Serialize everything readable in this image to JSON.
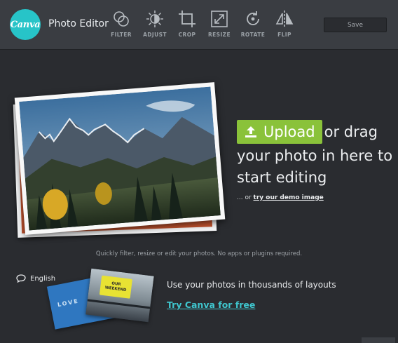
{
  "header": {
    "logo_text": "Canva",
    "app_title": "Photo Editor",
    "tools": [
      {
        "label": "FILTER",
        "icon": "filter-icon"
      },
      {
        "label": "ADJUST",
        "icon": "adjust-icon"
      },
      {
        "label": "CROP",
        "icon": "crop-icon"
      },
      {
        "label": "RESIZE",
        "icon": "resize-icon"
      },
      {
        "label": "ROTATE",
        "icon": "rotate-icon"
      },
      {
        "label": "FLIP",
        "icon": "flip-icon"
      }
    ],
    "save_label": "Save"
  },
  "upload": {
    "button_label": "Upload",
    "line1_suffix": "or drag",
    "line2": "your photo in here to",
    "line3": "start editing",
    "demo_prefix": "... or",
    "demo_link": "try our demo image"
  },
  "tagline": "Quickly filter, resize or edit your photos. No apps or plugins required.",
  "language": "English",
  "promo": {
    "text": "Use your photos in thousands of layouts",
    "link": "Try Canva for free",
    "card_text": "OUR WEEKEND",
    "blue_card_text": "LOVE"
  },
  "colors": {
    "brand": "#27c4c8",
    "upload_green": "#8ac23a",
    "link_teal": "#3fc6ce",
    "background": "#2a2c30",
    "toolbar": "#3a3d42"
  }
}
